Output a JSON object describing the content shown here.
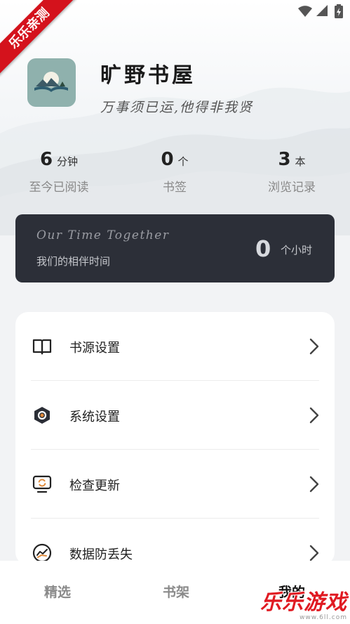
{
  "watermark": {
    "ribbon": "乐乐亲测",
    "brand": "乐乐游戏",
    "url": "www.6ll.com"
  },
  "profile": {
    "app_name": "旷野书屋",
    "motto": "万事须已运,他得非我贤"
  },
  "stats": [
    {
      "value": "6",
      "unit": "分钟",
      "label": "至今已阅读"
    },
    {
      "value": "0",
      "unit": "个",
      "label": "书签"
    },
    {
      "value": "3",
      "unit": "本",
      "label": "浏览记录"
    }
  ],
  "time_card": {
    "title_en": "Our Time Together",
    "title_cn": "我们的相伴时间",
    "hours": "0",
    "hours_unit": "个小时"
  },
  "menu": [
    {
      "label": "书源设置",
      "icon": "book-open-icon"
    },
    {
      "label": "系统设置",
      "icon": "hexagon-settings-icon"
    },
    {
      "label": "检查更新",
      "icon": "monitor-refresh-icon"
    },
    {
      "label": "数据防丢失",
      "icon": "chart-circle-icon"
    }
  ],
  "bottom_nav": {
    "tabs": [
      {
        "label": "精选"
      },
      {
        "label": "书架"
      },
      {
        "label": "我的"
      }
    ],
    "active": "我的"
  },
  "colors": {
    "card_dark": "#2c2f38",
    "ribbon_red": "#d4121c",
    "app_icon_bg": "#8fb1ad"
  }
}
